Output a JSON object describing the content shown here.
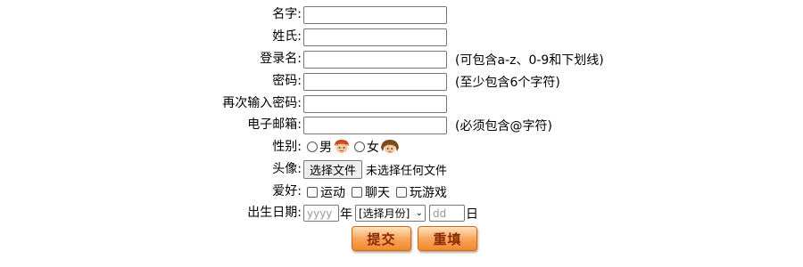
{
  "form": {
    "first_name_label": "名字:",
    "last_name_label": "姓氏:",
    "username_label": "登录名:",
    "username_hint": "(可包含a-z、0-9和下划线)",
    "password_label": "密码:",
    "password_hint": "(至少包含6个字符)",
    "confirm_password_label": "再次输入密码:",
    "email_label": "电子邮箱:",
    "email_hint": "(必须包含@字符)",
    "gender_label": "性别:",
    "gender_male": "男",
    "gender_female": "女",
    "avatar_label": "头像:",
    "file_button": "选择文件",
    "file_status": "未选择任何文件",
    "hobby_label": "爱好:",
    "hobby_sport": "运动",
    "hobby_chat": "聊天",
    "hobby_game": "玩游戏",
    "birthday_label": "出生日期:",
    "year_placeholder": "yyyy",
    "year_unit": "年",
    "month_select": "[选择月份]",
    "day_placeholder": "dd",
    "day_unit": "日",
    "submit_label": "提交",
    "reset_label": "重填"
  },
  "colors": {
    "button_orange": "#f18a2f",
    "button_text": "#8a2a00"
  },
  "icons": {
    "male_avatar": "boy-face-icon",
    "female_avatar": "girl-face-icon"
  }
}
